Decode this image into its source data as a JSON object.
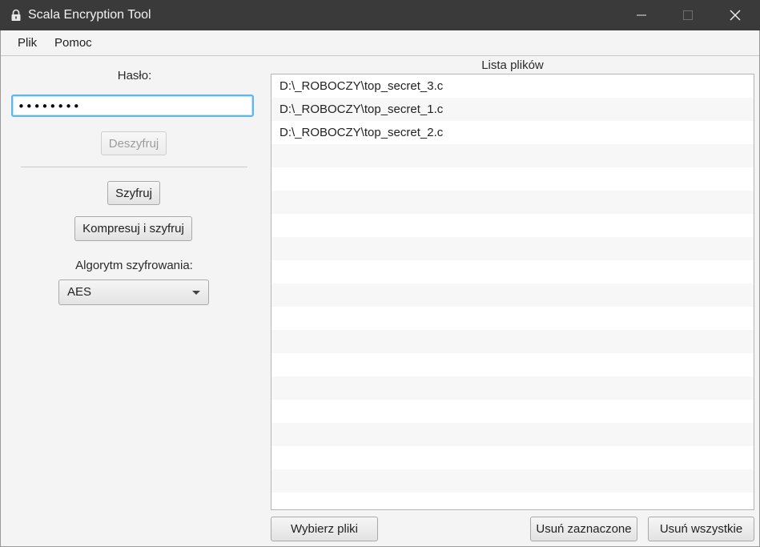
{
  "window": {
    "title": "Scala Encryption Tool",
    "icon": "lock-icon"
  },
  "menu": {
    "items": [
      "Plik",
      "Pomoc"
    ]
  },
  "left": {
    "password_label": "Hasło:",
    "password_value": "••••••••",
    "decrypt_label": "Deszyfruj",
    "encrypt_label": "Szyfruj",
    "compress_encrypt_label": "Kompresuj i szyfruj",
    "algorithm_label": "Algorytm szyfrowania:",
    "algorithm_value": "AES"
  },
  "right": {
    "list_title": "Lista plików",
    "files": [
      "D:\\_ROBOCZY\\top_secret_3.c",
      "D:\\_ROBOCZY\\top_secret_1.c",
      "D:\\_ROBOCZY\\top_secret_2.c"
    ],
    "choose_files_label": "Wybierz pliki",
    "remove_selected_label": "Usuń zaznaczone",
    "remove_all_label": "Usuń wszystkie"
  }
}
